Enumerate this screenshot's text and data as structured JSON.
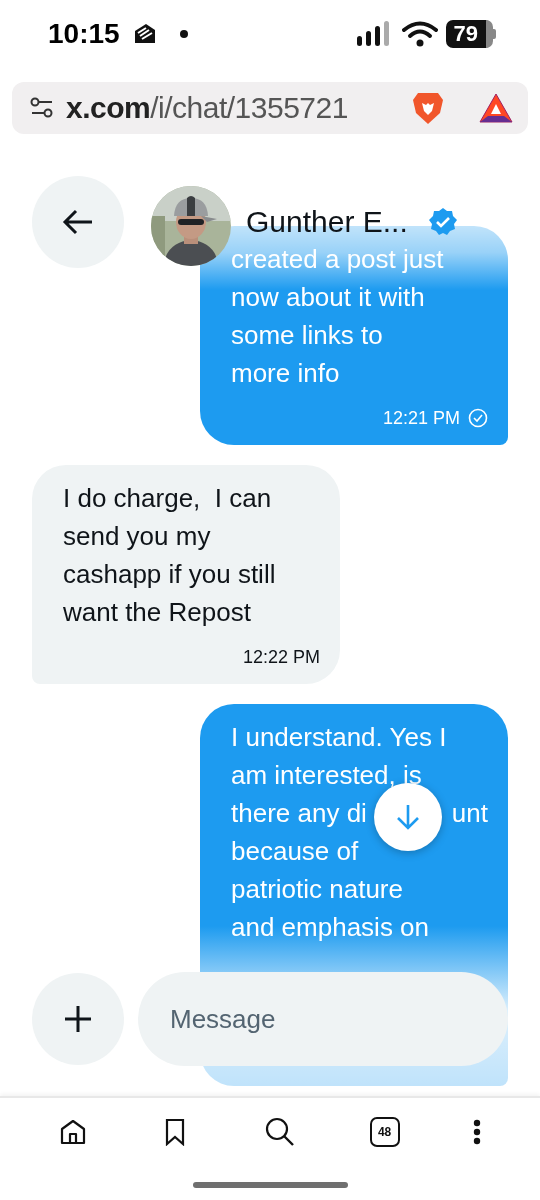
{
  "status_bar": {
    "time": "10:15",
    "battery": "79"
  },
  "address_bar": {
    "url": "**x.com**/i/chat/1355721"
  },
  "chat_header": {
    "name": "Gunther E...",
    "verified": true
  },
  "messages": [
    {
      "kind": "sent",
      "lines": [
        [
          "created a post just"
        ],
        [
          "now about it with"
        ],
        [
          "some links to"
        ],
        [
          "more info"
        ]
      ],
      "time": "12:21 PM"
    },
    {
      "kind": "received",
      "lines": [
        [
          "I do charge,  I can"
        ],
        [
          "send you my"
        ],
        [
          "cashapp if you still"
        ],
        [
          "want the Repost"
        ]
      ],
      "time": "12:22 PM"
    },
    {
      "kind": "sent",
      "lines": [
        [
          "I understand. Yes I"
        ],
        [
          "am interested, is"
        ],
        [
          "there any di",
          "unt"
        ],
        [
          "because of"
        ],
        [
          "patriotic nature"
        ],
        [
          "and emphasis on"
        ]
      ]
    }
  ],
  "composer": {
    "placeholder": "Message"
  },
  "bottom_nav": {
    "tab_count": "48"
  }
}
